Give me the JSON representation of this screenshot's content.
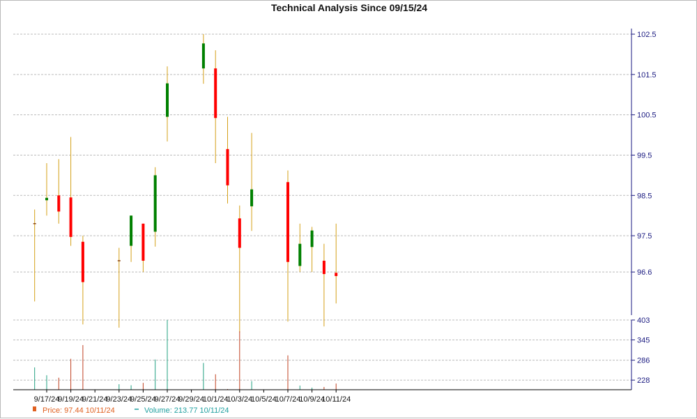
{
  "chart_data": {
    "type": "candlestick",
    "title": "Technical Analysis Since 09/15/24",
    "price_axis": {
      "ylim": [
        95.6,
        102.5
      ],
      "ticks": [
        "102.5",
        "101.5",
        "100.5",
        "99.5",
        "98.5",
        "97.5",
        "96.6"
      ],
      "tick_values": [
        102.5,
        101.5,
        100.5,
        99.5,
        98.5,
        97.5,
        96.6
      ]
    },
    "volume_axis": {
      "ylim": [
        200,
        403
      ],
      "ticks": [
        "403",
        "345",
        "286",
        "228"
      ],
      "tick_values": [
        403,
        345,
        286,
        228
      ]
    },
    "x_ticks": [
      "9/17/24",
      "9/19/24",
      "9/21/24",
      "9/23/24",
      "9/25/24",
      "9/27/24",
      "9/29/24",
      "10/1/24",
      "10/3/24",
      "10/5/24",
      "10/7/24",
      "10/9/24",
      "10/11/24"
    ],
    "x_tick_dates": [
      "2024-09-17",
      "2024-09-19",
      "2024-09-21",
      "2024-09-23",
      "2024-09-25",
      "2024-09-27",
      "2024-09-29",
      "2024-10-01",
      "2024-10-03",
      "2024-10-05",
      "2024-10-07",
      "2024-10-09",
      "2024-10-11"
    ],
    "candles": [
      {
        "date": "2024-09-16",
        "open": 97.8,
        "high": 98.15,
        "low": 95.87,
        "close": 97.8,
        "volume": 265
      },
      {
        "date": "2024-09-17",
        "open": 98.38,
        "high": 99.3,
        "low": 98.0,
        "close": 98.44,
        "volume": 242
      },
      {
        "date": "2024-09-18",
        "open": 98.5,
        "high": 99.4,
        "low": 97.8,
        "close": 98.1,
        "volume": 235
      },
      {
        "date": "2024-09-19",
        "open": 98.45,
        "high": 99.95,
        "low": 97.25,
        "close": 97.47,
        "volume": 290
      },
      {
        "date": "2024-09-20",
        "open": 97.35,
        "high": 97.5,
        "low": 95.3,
        "close": 96.35,
        "volume": 330
      },
      {
        "date": "2024-09-23",
        "open": 96.88,
        "high": 97.2,
        "low": 95.22,
        "close": 96.88,
        "volume": 216
      },
      {
        "date": "2024-09-24",
        "open": 97.25,
        "high": 98.0,
        "low": 96.85,
        "close": 98.0,
        "volume": 213
      },
      {
        "date": "2024-09-25",
        "open": 97.8,
        "high": 97.8,
        "low": 96.6,
        "close": 96.88,
        "volume": 220
      },
      {
        "date": "2024-09-26",
        "open": 97.6,
        "high": 99.2,
        "low": 97.23,
        "close": 99.0,
        "volume": 288
      },
      {
        "date": "2024-09-27",
        "open": 100.45,
        "high": 101.7,
        "low": 99.84,
        "close": 101.28,
        "volume": 403
      },
      {
        "date": "2024-09-30",
        "open": 101.65,
        "high": 102.5,
        "low": 101.27,
        "close": 102.27,
        "volume": 278
      },
      {
        "date": "2024-10-01",
        "open": 101.65,
        "high": 102.1,
        "low": 99.3,
        "close": 100.42,
        "volume": 245
      },
      {
        "date": "2024-10-02",
        "open": 99.65,
        "high": 100.45,
        "low": 98.3,
        "close": 98.75,
        "volume": 202
      },
      {
        "date": "2024-10-03",
        "open": 97.93,
        "high": 98.25,
        "low": 95.1,
        "close": 97.2,
        "volume": 370
      },
      {
        "date": "2024-10-04",
        "open": 98.23,
        "high": 100.05,
        "low": 97.62,
        "close": 98.65,
        "volume": 225
      },
      {
        "date": "2024-10-07",
        "open": 98.83,
        "high": 99.12,
        "low": 95.37,
        "close": 96.85,
        "volume": 300
      },
      {
        "date": "2024-10-08",
        "open": 96.75,
        "high": 97.8,
        "low": 96.6,
        "close": 97.3,
        "volume": 212
      },
      {
        "date": "2024-10-09",
        "open": 97.22,
        "high": 97.72,
        "low": 96.6,
        "close": 97.63,
        "volume": 206
      },
      {
        "date": "2024-10-10",
        "open": 96.88,
        "high": 97.3,
        "low": 95.25,
        "close": 96.55,
        "volume": 208
      },
      {
        "date": "2024-10-11",
        "open": 96.58,
        "high": 97.8,
        "low": 95.82,
        "close": 96.5,
        "volume": 218
      }
    ],
    "colors": {
      "up": "#008000",
      "down": "#ff0000",
      "wick": "#d4a017",
      "volume_up": "#20a080",
      "volume_down": "#c04020",
      "grid": "#bbbbbb",
      "axis": "#1a1a80"
    },
    "legend": {
      "price_label": "Price: 97.44  10/11/24",
      "price_color": "#e06020",
      "volume_label": "Volume: 213.77  10/11/24",
      "volume_color": "#20a0a0"
    },
    "grid": true
  }
}
